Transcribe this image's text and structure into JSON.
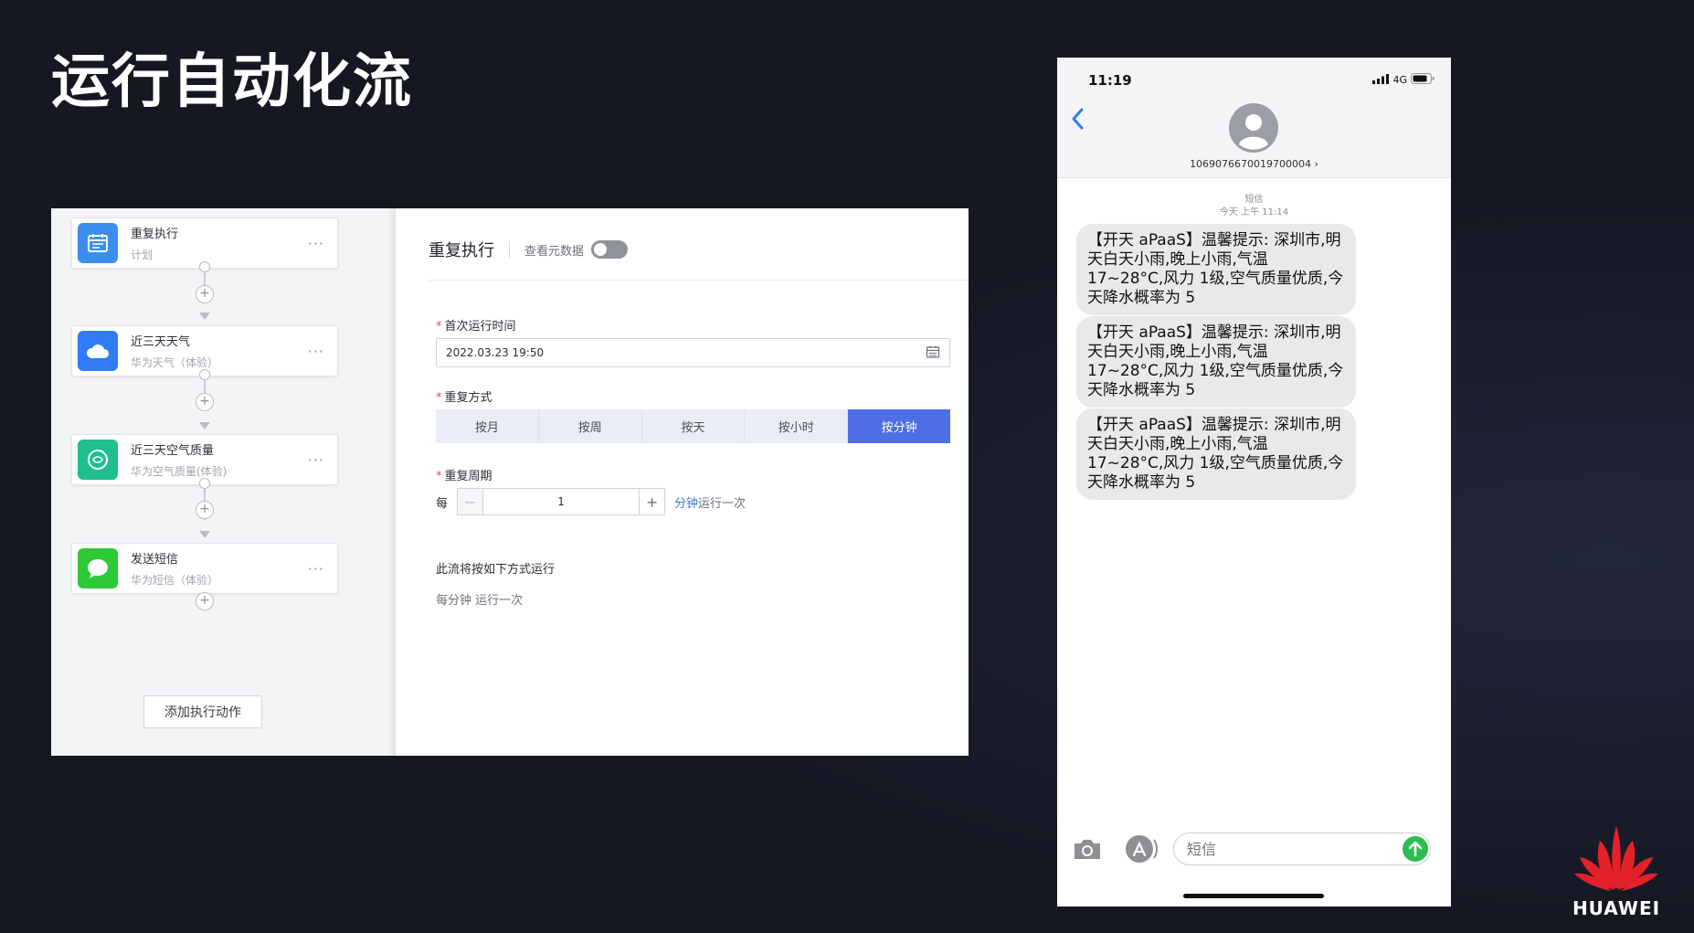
{
  "slide": {
    "title": "运行自动化流",
    "brand_name": "HUAWEI",
    "accent_color": "#4e6ee5"
  },
  "flow": {
    "nodes": [
      {
        "title": "重复执行",
        "subtitle": "计划",
        "icon": "calendar-icon",
        "color": "#3b8ef0"
      },
      {
        "title": "近三天天气",
        "subtitle": "华为天气（体验）",
        "icon": "cloud-icon",
        "color": "#2f7cf6"
      },
      {
        "title": "近三天空气质量",
        "subtitle": "华为空气质量(体验)",
        "icon": "air-quality-icon",
        "color": "#1fbf8f"
      },
      {
        "title": "发送短信",
        "subtitle": "华为短信（体验）",
        "icon": "message-icon",
        "color": "#2dc937"
      }
    ],
    "more_label": "···",
    "plus_label": "+",
    "add_action_label": "添加执行动作"
  },
  "config": {
    "title": "重复执行",
    "meta_label": "查看元数据",
    "first_run_label": "首次运行时间",
    "required_mark": "*",
    "first_run_value": "2022.03.23 19:50",
    "repeat_mode_label": "重复方式",
    "repeat_modes": [
      "按月",
      "按周",
      "按天",
      "按小时",
      "按分钟"
    ],
    "selected_mode": "按分钟",
    "interval_label": "重复周期",
    "interval_prefix": "每",
    "interval_value": "1",
    "stepper_minus": "−",
    "stepper_plus": "+",
    "interval_unit": "分钟",
    "interval_suffix": "运行一次",
    "run_desc_label": "此流将按如下方式运行",
    "run_desc_value": "每分钟 运行一次"
  },
  "phone": {
    "time": "11:19",
    "network": "4G",
    "back_label": "<",
    "sender": "1069076670019700004 ›",
    "msg_type": "短信",
    "msg_time": "今天 上午 11:14",
    "messages": [
      "【开天 aPaaS】温馨提示: 深圳市,明天白天小雨,晚上小雨,气温 17~28°C,风力 1级,空气质量优质,今天降水概率为 5",
      "【开天 aPaaS】温馨提示: 深圳市,明天白天小雨,晚上小雨,气温 17~28°C,风力 1级,空气质量优质,今天降水概率为 5",
      "【开天 aPaaS】温馨提示: 深圳市,明天白天小雨,晚上小雨,气温 17~28°C,风力 1级,空气质量优质,今天降水概率为 5"
    ],
    "input_placeholder": "短信",
    "bubble_color": "#e9e9eb",
    "send_color": "#2dbd4e"
  }
}
